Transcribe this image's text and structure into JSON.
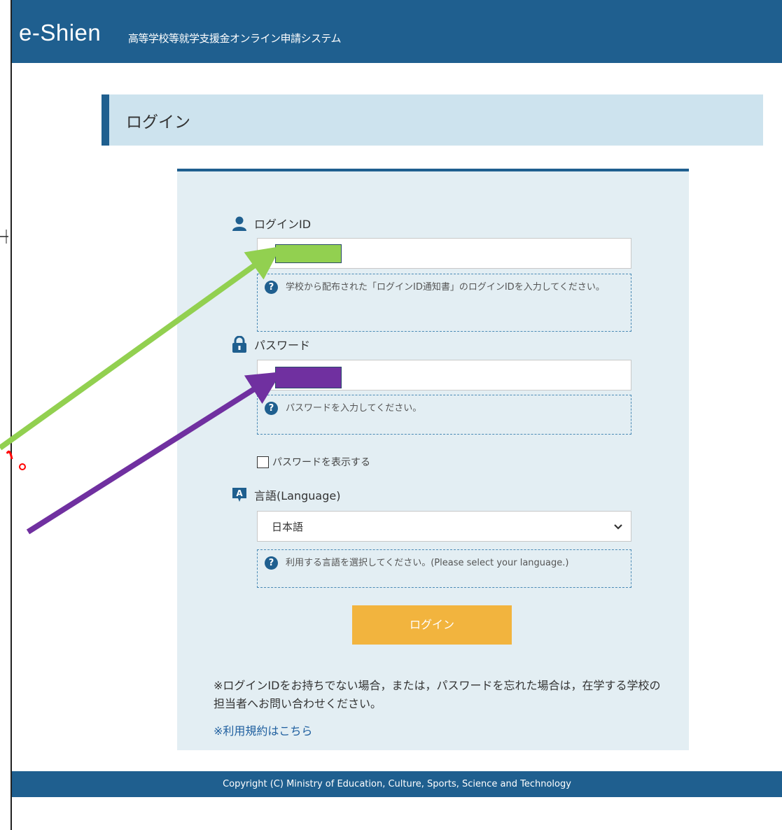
{
  "header": {
    "logo": "e-Shien",
    "subtitle": "高等学校等就学支援金オンライン申請システム"
  },
  "page_heading": "ログイン",
  "form": {
    "login_id": {
      "label": "ログインID",
      "icon": "user-icon",
      "value": "",
      "help": "学校から配布された「ログインID通知書」のログインIDを入力してください。"
    },
    "password": {
      "label": "パスワード",
      "icon": "lock-icon",
      "value": "",
      "help": "パスワードを入力してください。"
    },
    "show_password": {
      "label": "パスワードを表示する",
      "checked": false
    },
    "language": {
      "label": "言語(Language)",
      "icon": "language-icon",
      "selected": "日本語",
      "help": "利用する言語を選択してください。(Please select your language.)"
    },
    "submit_label": "ログイン"
  },
  "note": "※ログインIDをお持ちでない場合，または，パスワードを忘れた場合は，在学する学校の担当者へお問い合わせください。",
  "terms_link": "※利用規約はこちら",
  "footer": "Copyright (C) Ministry of Education, Culture, Sports, Science and Technology",
  "annotations": {
    "login_id_highlight_color": "#92d050",
    "password_highlight_color": "#7030a0",
    "marker_color": "#ff0000"
  }
}
